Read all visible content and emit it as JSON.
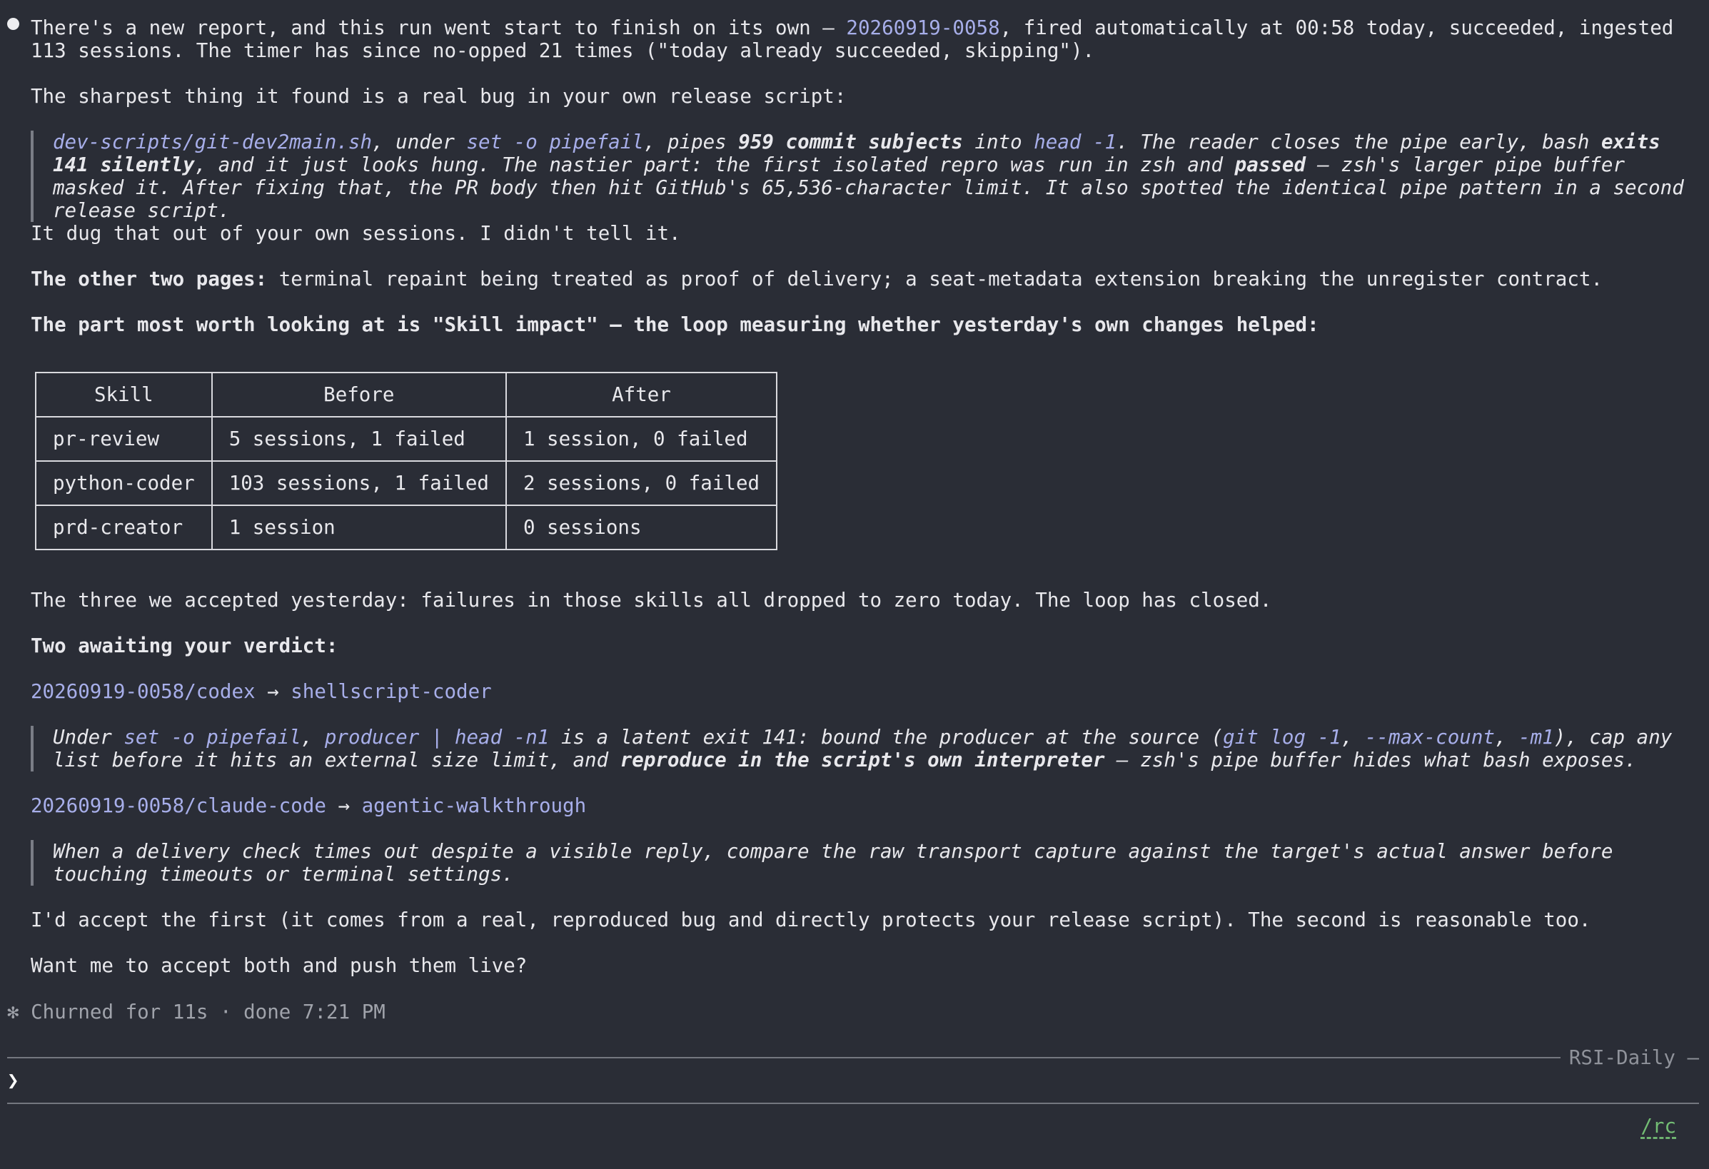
{
  "intro": {
    "prefix": "There's a new report, and this run went start to finish on its own — ",
    "run_id": "20260919-0058",
    "suffix": ", fired automatically at 00:58 today, succeeded, ingested 113 sessions. The timer has since no-opped 21 times (\"today already succeeded, skipping\")."
  },
  "bug_intro": "The sharpest thing it found is a real bug in your own release script:",
  "bug_quote": {
    "script_path": "dev-scripts/git-dev2main.sh",
    "t1": ", under ",
    "pipefail": "set -o pipefail",
    "t2": ", pipes ",
    "subjects": "959 commit subjects",
    "t3": " into ",
    "head": "head -1",
    "t4": ". The reader closes the pipe early, bash ",
    "exits": "exits 141 silently",
    "t5": ", and it just looks hung. The nastier part: the first isolated repro was run in zsh and ",
    "passed": "passed",
    "t6": " — zsh's larger pipe buffer masked it. After fixing that, the PR body then hit GitHub's 65,536-character limit. It also spotted the identical pipe pattern in a second release script."
  },
  "dug_out": "It dug that out of your own sessions. I didn't tell it.",
  "other_pages": {
    "label": "The other two pages:",
    "text": " terminal repaint being treated as proof of delivery; a seat-metadata extension breaking the unregister contract."
  },
  "skill_impact_heading": "The part most worth looking at is \"Skill impact\" — the loop measuring whether yesterday's own changes helped:",
  "table": {
    "headers": [
      "Skill",
      "Before",
      "After"
    ],
    "rows": [
      [
        "pr-review",
        "5 sessions, 1 failed",
        "1 session, 0 failed"
      ],
      [
        "python-coder",
        "103 sessions, 1 failed",
        "2 sessions, 0 failed"
      ],
      [
        "prd-creator",
        "1 session",
        "0 sessions"
      ]
    ]
  },
  "accepted_summary": "The three we accepted yesterday: failures in those skills all dropped to zero today. The loop has closed.",
  "awaiting_heading": "Two awaiting your verdict:",
  "proposals": [
    {
      "source": "20260919-0058/codex",
      "arrow": " → ",
      "target": "shellscript-coder",
      "q": {
        "t1": "Under ",
        "c1": "set -o pipefail",
        "t2": ", ",
        "c2": "producer | head -n1",
        "t3": " is a latent exit 141: bound the producer at the source (",
        "c3": "git log -1",
        "t4": ", ",
        "c4": "--max-count",
        "t5": ", ",
        "c5": "-m1",
        "t6": "), cap any list before it hits an external size limit, and ",
        "bold": "reproduce in the script's own interpreter",
        "t7": " — zsh's pipe buffer hides what bash exposes."
      }
    },
    {
      "source": "20260919-0058/claude-code",
      "arrow": " → ",
      "target": "agentic-walkthrough",
      "text": "When a delivery check times out despite a visible reply, compare the raw transport capture against the target's actual answer before touching timeouts or terminal settings."
    }
  ],
  "recommendation": "I'd accept the first (it comes from a real, reproduced bug and directly protects your release script). The second is reasonable too.",
  "question": "Want me to accept both and push them live?",
  "status_line": "✻ Churned for 11s · done 7:21 PM",
  "session_label": "RSI-Daily —",
  "prompt_symbol": "❯",
  "footer_command": "/rc"
}
